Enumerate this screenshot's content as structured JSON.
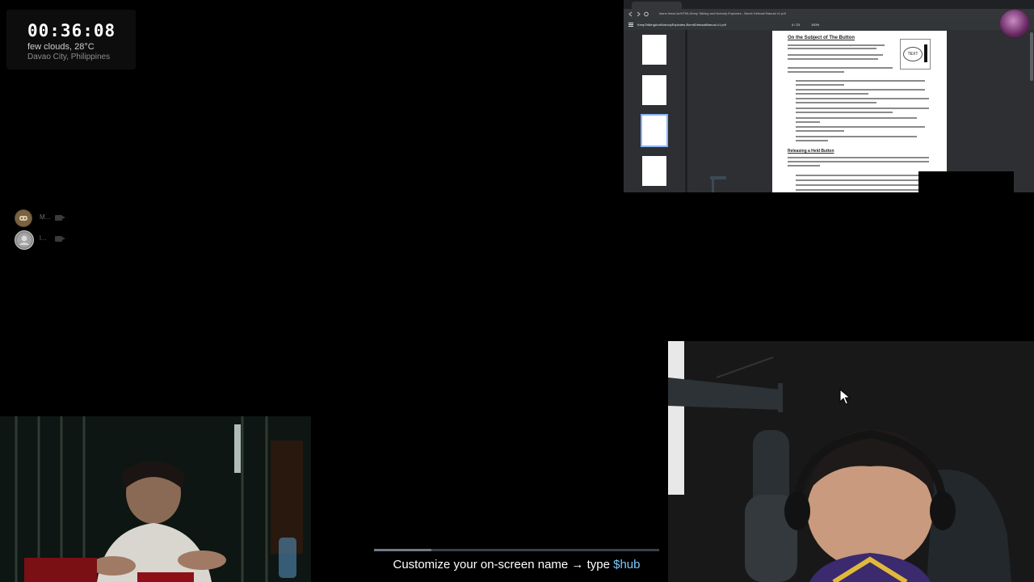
{
  "clock": {
    "time": "00:36:08",
    "weather": "few clouds, 28°C",
    "location": "Davao City, Philippines"
  },
  "voice": {
    "users": [
      {
        "name": "M...",
        "avatar_color": "#6e5a3a",
        "icon": "discord-icon"
      },
      {
        "name": "l...",
        "avatar_color": "#9a9a9a",
        "icon": "avatar-icon"
      }
    ]
  },
  "browser": {
    "tab_title": "KeepTalkingAndNobodyExplodes",
    "url": "ktane.timwi.de/HTML/Keep Talking and Nobody Explodes - Bomb Defusal Manual v1.pdf",
    "pdf_name": "KeepTalkingAndNobodyExplodes-BombDefusalManual-v1.pdf",
    "page_indicator": "4 / 23",
    "zoom": "100%",
    "page": {
      "heading": "On the Subject of The Button",
      "section_heading": "Releasing a Held Button",
      "button_label": "TEXT"
    }
  },
  "banner": {
    "text_prefix": "Customize your on-screen name → type ",
    "command": "$hub",
    "progress": 0.2
  },
  "colors": {
    "background": "#000000",
    "banner_command": "#7ec8ff",
    "thumb_selected": "#8ab4f8"
  }
}
